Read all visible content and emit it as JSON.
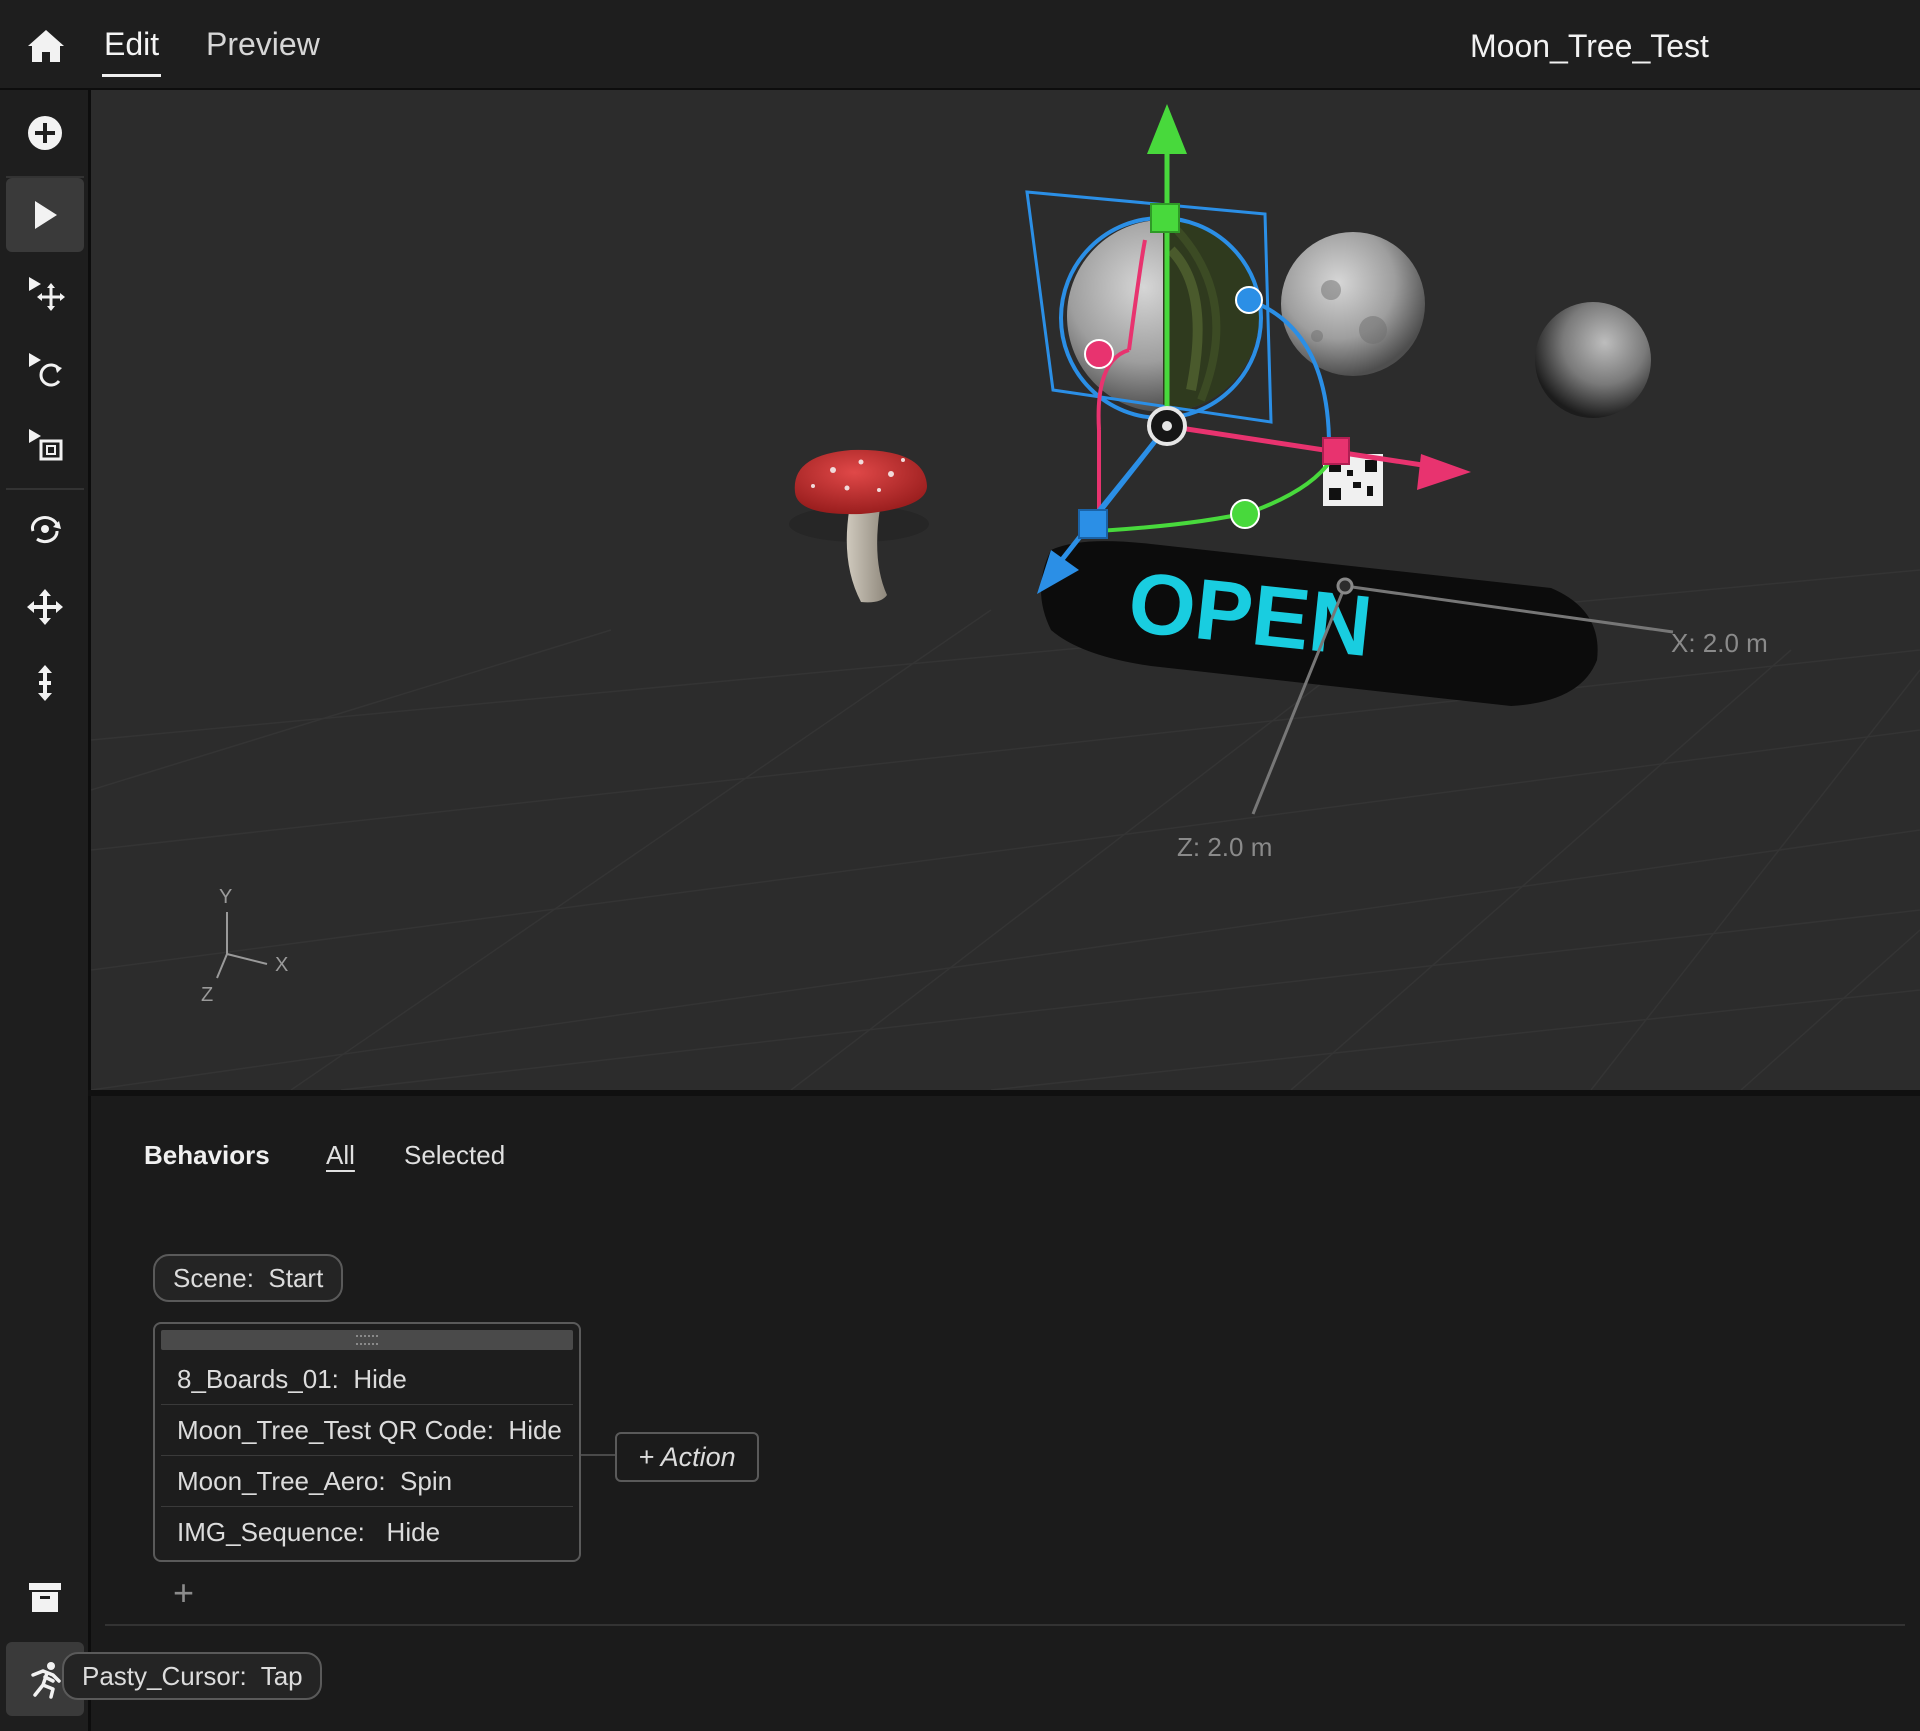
{
  "topbar": {
    "tabs": [
      {
        "label": "Edit",
        "active": true
      },
      {
        "label": "Preview",
        "active": false
      }
    ],
    "project_title": "Moon_Tree_Test"
  },
  "toolbar": {
    "tools": [
      {
        "icon": "add-circle-icon",
        "active": false
      },
      {
        "icon": "select-arrow-icon",
        "active": true
      },
      {
        "icon": "move-tool-icon",
        "active": false
      },
      {
        "icon": "rotate-tool-icon",
        "active": false
      },
      {
        "icon": "scale-tool-icon",
        "active": false
      },
      {
        "icon": "orbit-icon",
        "active": false
      },
      {
        "icon": "pan-icon",
        "active": false
      },
      {
        "icon": "dolly-icon",
        "active": false
      }
    ],
    "bottom_tools": [
      {
        "icon": "archive-icon",
        "active": false
      },
      {
        "icon": "behaviors-runner-icon",
        "active": true
      }
    ]
  },
  "viewport": {
    "sign_text": "OPEN",
    "x_dimension": "X:  2.0 m",
    "z_dimension": "Z:  2.0 m",
    "axis_labels": {
      "y": "Y",
      "x": "X",
      "z": "Z"
    },
    "colors": {
      "background": "#2c2c2c",
      "x_axis": "#e8336f",
      "y_axis": "#48d93c",
      "z_axis": "#2b8fe6",
      "sign_text": "#19cde0"
    }
  },
  "behaviors": {
    "title": "Behaviors",
    "filters": [
      {
        "label": "All",
        "active": true
      },
      {
        "label": "Selected",
        "active": false
      }
    ],
    "triggers": [
      {
        "label": "Scene:  Start",
        "actions": [
          "8_Boards_01:  Hide",
          "Moon_Tree_Test QR Code:  Hide",
          "Moon_Tree_Aero:  Spin",
          "IMG_Sequence:   Hide"
        ],
        "add_action_label": "+ Action"
      },
      {
        "label": "Pasty_Cursor:  Tap",
        "actions": []
      }
    ],
    "add_behavior_label": "+"
  }
}
